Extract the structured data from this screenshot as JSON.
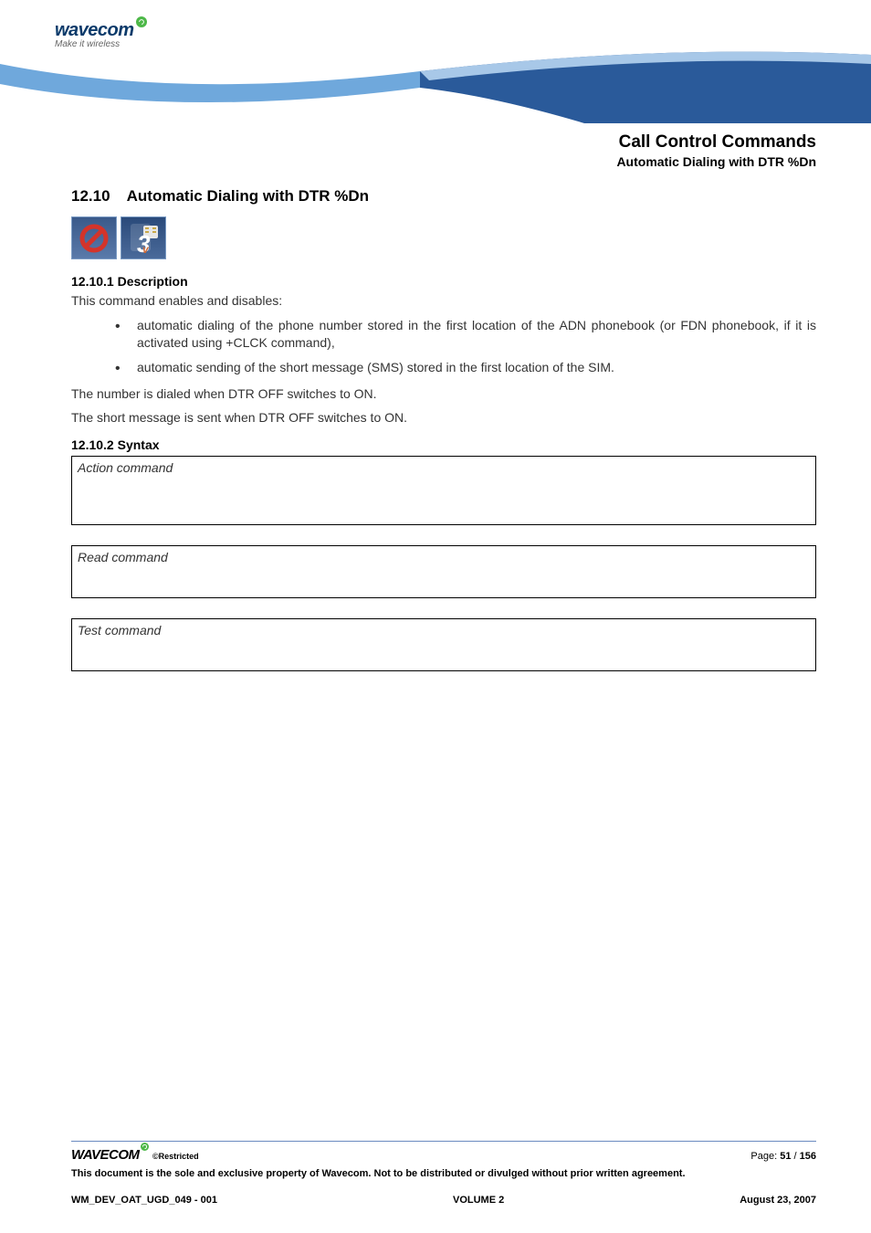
{
  "header": {
    "logo_text": "wavecom",
    "tagline": "Make it wireless"
  },
  "breadcrumb": {
    "main": "Call Control Commands",
    "sub": "Automatic Dialing with DTR %Dn"
  },
  "section": {
    "number": "12.10",
    "title": "Automatic Dialing with DTR %Dn"
  },
  "sub1": {
    "number": "12.10.1",
    "title": "Description",
    "intro": "This command enables and disables:",
    "bullets": [
      "automatic dialing of the phone number stored in the first location of the ADN phonebook (or FDN phonebook, if it is activated using +CLCK command),",
      "automatic sending of the short message (SMS) stored in the first location of the SIM."
    ],
    "p1": "The number is dialed when DTR OFF switches to ON.",
    "p2": "The short message is sent when DTR OFF switches to ON."
  },
  "sub2": {
    "number": "12.10.2",
    "title": "Syntax",
    "boxes": {
      "action": "Action command",
      "read": "Read command",
      "test": "Test command"
    }
  },
  "footer": {
    "logo": "WAVECOM",
    "restricted": "©Restricted",
    "page_label": "Page: ",
    "page_current": "51",
    "page_sep": " / ",
    "page_total": "156",
    "disclaimer": "This document is the sole and exclusive property of Wavecom. Not to be distributed or divulged without prior written agreement.",
    "doc_id": "WM_DEV_OAT_UGD_049 - 001",
    "volume": "VOLUME 2",
    "date": "August 23, 2007"
  }
}
